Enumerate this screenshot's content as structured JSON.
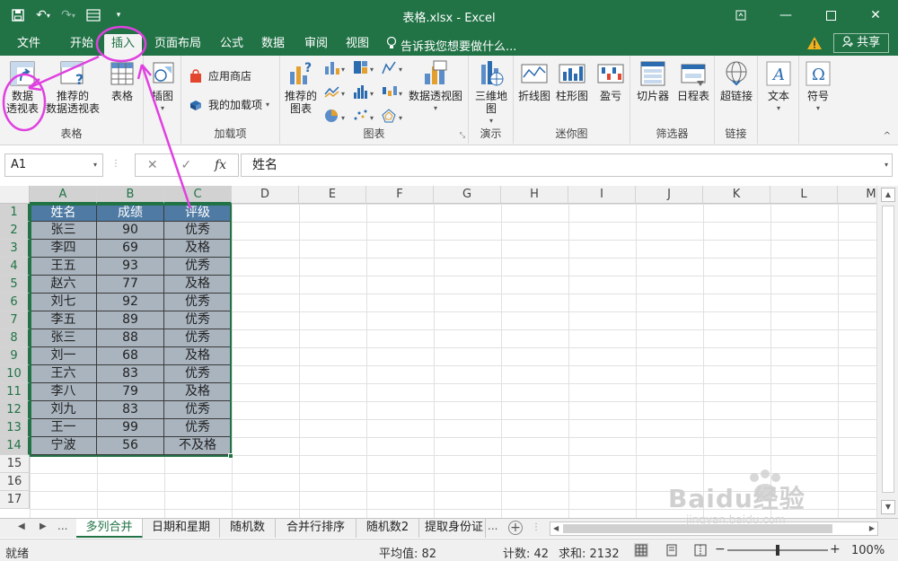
{
  "window": {
    "title": "表格.xlsx - Excel"
  },
  "tabs": [
    {
      "label": "文件",
      "x": 0
    },
    {
      "label": "开始"
    },
    {
      "label": "插入"
    },
    {
      "label": "页面布局"
    },
    {
      "label": "公式"
    },
    {
      "label": "数据"
    },
    {
      "label": "审阅"
    },
    {
      "label": "视图"
    }
  ],
  "tellme": "告诉我您想要做什么...",
  "share": "共享",
  "ribbon": {
    "tables": {
      "label": "表格",
      "pivot": "数据\n透视表",
      "recommended_pivot": "推荐的\n数据透视表",
      "table": "表格"
    },
    "illustrations": {
      "label": "插图"
    },
    "addins": {
      "label": "加载项",
      "store": "应用商店",
      "my_addins": "我的加载项"
    },
    "charts": {
      "label": "图表",
      "recommended": "推荐的\n图表",
      "pivot_chart": "数据透视图"
    },
    "tours": {
      "label": "演示",
      "map3d": "三维地\n图"
    },
    "sparklines": {
      "label": "迷你图",
      "line": "折线图",
      "column": "柱形图",
      "winloss": "盈亏"
    },
    "filters": {
      "label": "筛选器",
      "slicer": "切片器",
      "timeline": "日程表"
    },
    "links": {
      "label": "链接",
      "hyperlink": "超链接"
    },
    "text": {
      "label": "文本"
    },
    "symbols": {
      "label": "符号"
    }
  },
  "formula_bar": {
    "name_box": "A1",
    "formula": "姓名"
  },
  "columns": [
    "A",
    "B",
    "C",
    "D",
    "E",
    "F",
    "G",
    "H",
    "I",
    "J",
    "K",
    "L",
    "M"
  ],
  "rows": [
    "1",
    "2",
    "3",
    "4",
    "5",
    "6",
    "7",
    "8",
    "9",
    "10",
    "11",
    "12",
    "13",
    "14",
    "15",
    "16",
    "17"
  ],
  "table": {
    "headers": [
      "姓名",
      "成绩",
      "评级"
    ],
    "rows": [
      [
        "张三",
        "90",
        "优秀"
      ],
      [
        "李四",
        "69",
        "及格"
      ],
      [
        "王五",
        "93",
        "优秀"
      ],
      [
        "赵六",
        "77",
        "及格"
      ],
      [
        "刘七",
        "92",
        "优秀"
      ],
      [
        "李五",
        "89",
        "优秀"
      ],
      [
        "张三",
        "88",
        "优秀"
      ],
      [
        "刘一",
        "68",
        "及格"
      ],
      [
        "王六",
        "83",
        "优秀"
      ],
      [
        "李八",
        "79",
        "及格"
      ],
      [
        "刘九",
        "83",
        "优秀"
      ],
      [
        "王一",
        "99",
        "优秀"
      ],
      [
        "宁波",
        "56",
        "不及格"
      ]
    ]
  },
  "sheets": {
    "tabs": [
      "多列合并",
      "日期和星期",
      "随机数",
      "合并行排序",
      "随机数2",
      "提取身份证"
    ],
    "active": "多列合并",
    "more": "..."
  },
  "status": {
    "ready": "就绪",
    "average": "平均值: 82",
    "count": "计数: 42",
    "sum": "求和: 2132",
    "zoom": "100%"
  },
  "colors": {
    "brand": "#217346",
    "header_fill": "#4f7aa3",
    "body_fill": "#a9b4bf",
    "annotation": "#e040e0"
  },
  "watermark": {
    "text": "Baidu经验",
    "url": "jingyan.baidu.com"
  }
}
